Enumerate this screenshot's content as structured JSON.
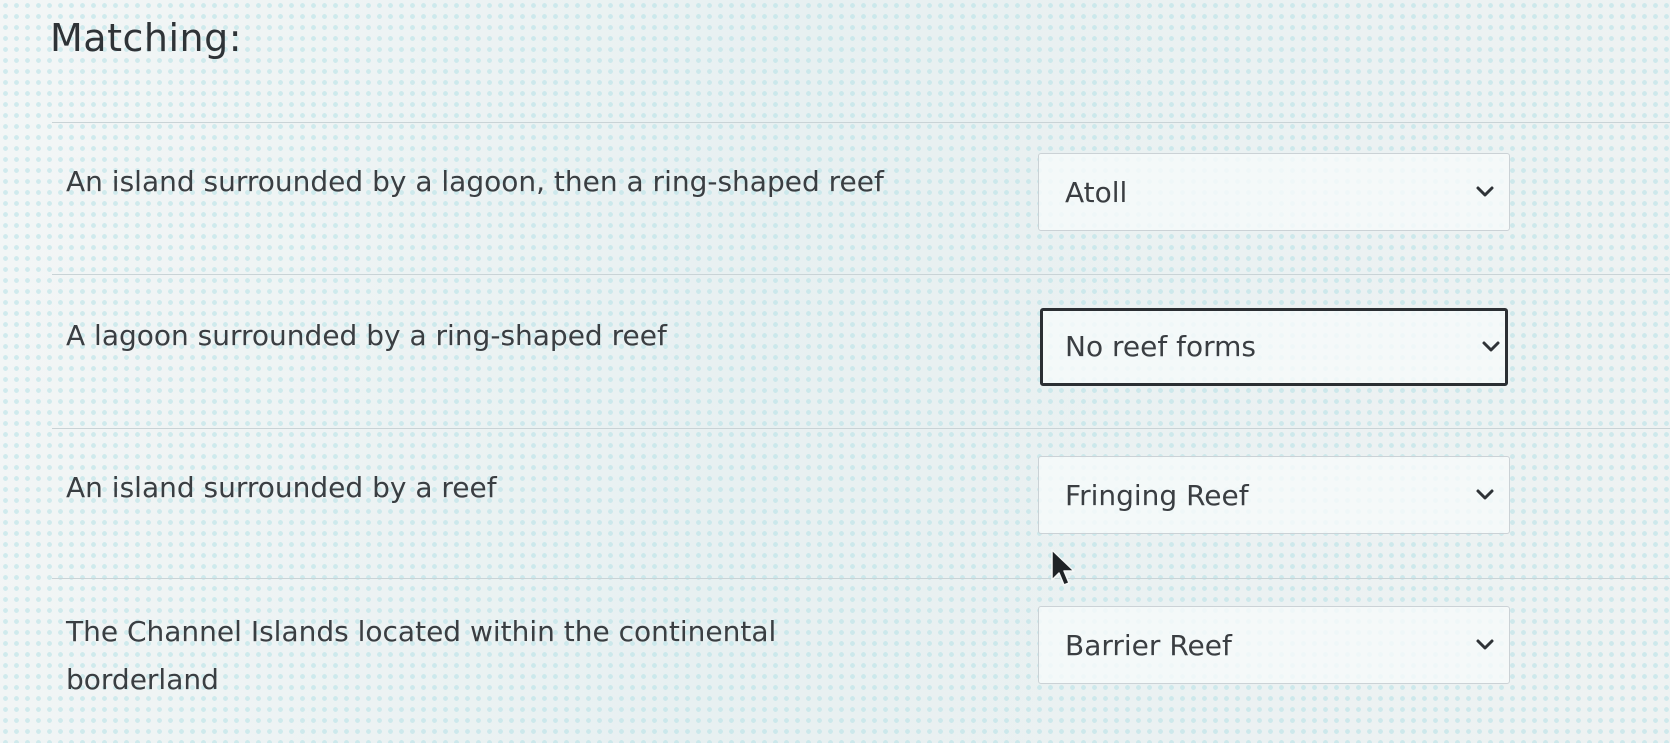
{
  "heading": "Matching:",
  "rows": [
    {
      "prompt": "An island surrounded by a lagoon, then a ring-shaped reef",
      "selected": "Atoll"
    },
    {
      "prompt": "A lagoon surrounded by a ring-shaped reef",
      "selected": "No reef forms"
    },
    {
      "prompt": "An island surrounded by a reef",
      "selected": "Fringing Reef"
    },
    {
      "prompt": "The Channel Islands located within the continental borderland",
      "selected": "Barrier Reef"
    }
  ],
  "icons": {
    "dropdown": "chevron-down-icon",
    "pointer": "mouse-pointer-icon"
  },
  "colors": {
    "text": "#3a3e42",
    "focused_border": "#2b2f33",
    "border": "#cbd2d6"
  }
}
